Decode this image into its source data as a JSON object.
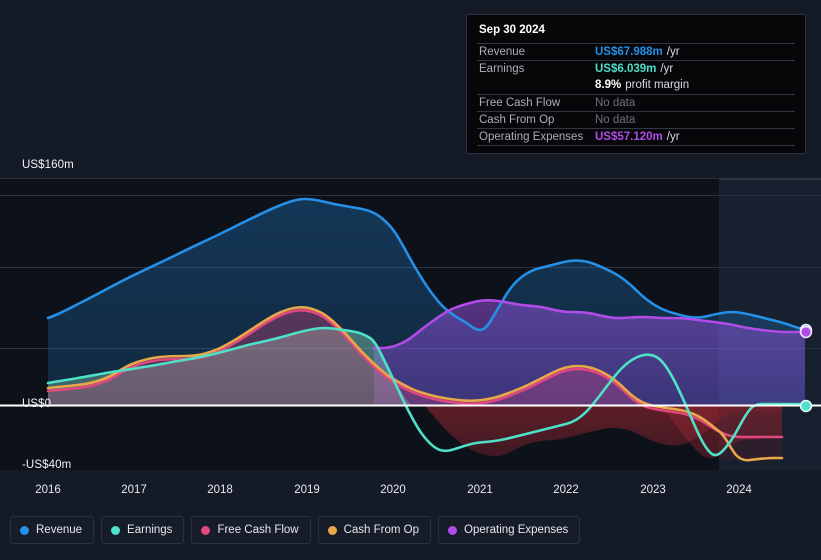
{
  "colors": {
    "background": "#141a26",
    "plot_background": "#0d1119",
    "revenue": "#2490e8",
    "earnings": "#4fe0c8",
    "free_cash_flow": "#e0487f",
    "cash_from_op": "#e8a84a",
    "operating_expenses": "#b04ce8",
    "zero_line": "#ffffff",
    "gridline": "#2a3240"
  },
  "tooltip": {
    "date": "Sep 30 2024",
    "rows": [
      {
        "key": "Revenue",
        "value": "US$67.988m",
        "unit": "/yr",
        "color": "#2490e8",
        "no_data": false
      },
      {
        "key": "Earnings",
        "value": "US$6.039m",
        "unit": "/yr",
        "color": "#4fe0c8",
        "no_data": false
      },
      {
        "key": "",
        "value": "8.9%",
        "unit": "profit margin",
        "color": "#ffffff",
        "no_data": false,
        "sub": true
      },
      {
        "key": "Free Cash Flow",
        "value": "No data",
        "unit": "",
        "color": "#6d727c",
        "no_data": true
      },
      {
        "key": "Cash From Op",
        "value": "No data",
        "unit": "",
        "color": "#6d727c",
        "no_data": true
      },
      {
        "key": "Operating Expenses",
        "value": "US$57.120m",
        "unit": "/yr",
        "color": "#b04ce8",
        "no_data": false
      }
    ]
  },
  "legend": {
    "items": [
      {
        "label": "Revenue",
        "color": "#2490e8"
      },
      {
        "label": "Earnings",
        "color": "#4fe0c8"
      },
      {
        "label": "Free Cash Flow",
        "color": "#e0487f"
      },
      {
        "label": "Cash From Op",
        "color": "#e8a84a"
      },
      {
        "label": "Operating Expenses",
        "color": "#b04ce8"
      }
    ]
  },
  "axes": {
    "y_labels": [
      {
        "text": "US$160m",
        "value": 160
      },
      {
        "text": "US$0",
        "value": 0
      },
      {
        "text": "-US$40m",
        "value": -40
      }
    ],
    "x_labels": [
      "2016",
      "2017",
      "2018",
      "2019",
      "2020",
      "2021",
      "2022",
      "2023",
      "2024"
    ]
  },
  "chart_data": {
    "type": "area",
    "title": "",
    "xlabel": "",
    "ylabel": "US$",
    "ylim": [
      -40,
      160
    ],
    "xlim": [
      2015.8,
      2024.9
    ],
    "grid": true,
    "legend_position": "bottom",
    "currency": "USD",
    "units": "millions",
    "x": [
      2015.8,
      2016.0,
      2016.25,
      2016.5,
      2016.75,
      2017.0,
      2017.25,
      2017.5,
      2017.75,
      2018.0,
      2018.25,
      2018.5,
      2018.75,
      2019.0,
      2019.25,
      2019.5,
      2019.75,
      2020.0,
      2020.25,
      2020.5,
      2020.75,
      2021.0,
      2021.25,
      2021.5,
      2021.75,
      2022.0,
      2022.25,
      2022.5,
      2022.75,
      2023.0,
      2023.25,
      2023.5,
      2023.75,
      2024.0,
      2024.25,
      2024.5,
      2024.75
    ],
    "series": [
      {
        "name": "Revenue",
        "color": "#2490e8",
        "values": [
          57,
          62,
          68,
          74,
          80,
          86,
          92,
          98,
          104,
          110,
          116,
          124,
          131,
          135,
          136,
          134,
          131,
          128,
          112,
          96,
          90,
          88,
          72,
          64,
          86,
          104,
          106,
          102,
          100,
          92,
          88,
          84,
          86,
          82,
          78,
          73,
          68
        ]
      },
      {
        "name": "Earnings",
        "color": "#4fe0c8",
        "values": [
          11,
          12,
          13,
          14,
          15,
          16,
          17,
          18,
          20,
          22,
          24,
          34,
          42,
          44,
          42,
          41,
          41,
          22,
          2,
          -12,
          -18,
          -16,
          -14,
          -12,
          -9,
          -6,
          -4,
          -2,
          -8,
          -16,
          -14,
          -13,
          -28,
          -26,
          4,
          5,
          6
        ]
      },
      {
        "name": "Free Cash Flow",
        "color": "#e0487f",
        "values": [
          8,
          9,
          10,
          11,
          13,
          18,
          24,
          26,
          27,
          27,
          28,
          36,
          44,
          48,
          46,
          41,
          38,
          36,
          14,
          4,
          2,
          2,
          3,
          4,
          8,
          14,
          16,
          15,
          8,
          -4,
          -6,
          -6,
          -22,
          -20,
          -18,
          null,
          null
        ]
      },
      {
        "name": "Cash From Op",
        "color": "#e8a84a",
        "values": [
          8,
          9,
          10,
          11,
          13,
          19,
          25,
          27,
          28,
          28,
          29,
          37,
          45,
          49,
          47,
          42,
          39,
          37,
          15,
          5,
          3,
          3,
          4,
          5,
          9,
          15,
          17,
          16,
          9,
          -3,
          -5,
          -5,
          -21,
          -19,
          -17,
          null,
          null
        ]
      },
      {
        "name": "Operating Expenses",
        "color": "#b04ce8",
        "values": [
          null,
          null,
          null,
          null,
          null,
          null,
          null,
          null,
          null,
          null,
          null,
          null,
          null,
          null,
          null,
          27,
          27,
          28,
          38,
          50,
          58,
          62,
          64,
          62,
          58,
          60,
          60,
          61,
          62,
          62,
          62,
          62,
          61,
          60,
          59,
          58,
          57
        ]
      }
    ],
    "endpoints": [
      {
        "name": "Revenue",
        "value": 67.988,
        "color": "#2490e8"
      },
      {
        "name": "Operating Expenses",
        "value": 57.12,
        "color": "#b04ce8"
      },
      {
        "name": "Earnings",
        "value": 6.039,
        "color": "#4fe0c8"
      }
    ],
    "forecast_band": {
      "start_year": 2023.78,
      "label": ""
    }
  }
}
